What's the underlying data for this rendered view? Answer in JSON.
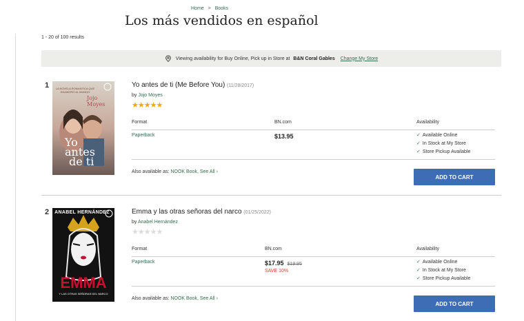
{
  "breadcrumb": {
    "home": "Home",
    "sep": ">",
    "books": "Books"
  },
  "page_title": "Los más vendidos en español",
  "results_text": "1 - 20 of 100 results",
  "availability_bar": {
    "prefix": "Viewing availability for Buy Online, Pick up in Store at",
    "store": "B&N Coral Gables",
    "change_link": "Change My Store"
  },
  "table_headers": {
    "format": "Format",
    "price": "BN.com",
    "availability": "Availability"
  },
  "add_to_cart_label": "ADD TO CART",
  "also_available_label": "Also available as:",
  "products": [
    {
      "rank": "1",
      "title": "Yo antes de ti (Me Before You)",
      "date": "(11/28/2017)",
      "by": "by",
      "author": "Jojo Moyes",
      "rating": 5,
      "format": "Paperback",
      "price": "$13.95",
      "was_price": "",
      "save": "",
      "availability": [
        "Available Online",
        "In Stock at My Store",
        "Store Pickup Available"
      ],
      "also_format": "NOOK Book,",
      "see_all": "See All",
      "cover": {
        "top_text": "LA NOVELA ROMANTICA QUE ENAMORO AL MUNDO",
        "author": "Jojo Moyes",
        "title_1": "Yo",
        "title_2": "antes",
        "title_3": "de ti"
      }
    },
    {
      "rank": "2",
      "title": "Emma y las otras señoras del narco",
      "date": "(01/25/2022)",
      "by": "by",
      "author": "Anabel Hernández",
      "rating": 0,
      "format": "Paperback",
      "price": "$17.95",
      "was_price": "$19.95",
      "save": "SAVE 10%",
      "availability": [
        "Available Online",
        "In Stock at My Store",
        "Store Pickup Available"
      ],
      "also_format": "NOOK Book,",
      "see_all": "See All",
      "cover": {
        "author": "ANABEL HERNÁNDEZ",
        "title": "EMMA",
        "subtitle": "Y LAS OTRAS SEÑORAS DEL NARCO"
      }
    }
  ],
  "colors": {
    "link_green": "#346c50",
    "cart_blue": "#3e6db6",
    "star_gold": "#f0a800",
    "save_red": "#d6422c",
    "bar_bg": "#ededea"
  }
}
